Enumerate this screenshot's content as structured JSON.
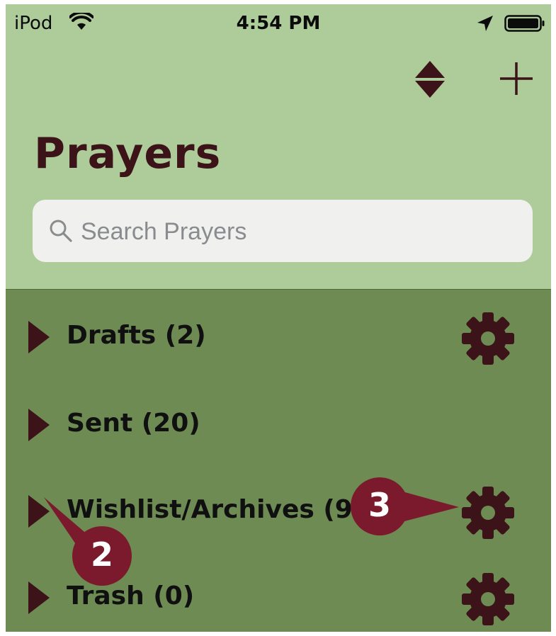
{
  "status_bar": {
    "carrier": "iPod",
    "time": "4:54 PM",
    "wifi_icon": "wifi-icon",
    "location_icon": "location-arrow-icon",
    "battery_icon": "battery-full-icon"
  },
  "toolbar": {
    "sort_icon": "sort-updown-icon",
    "add_icon": "plus-icon"
  },
  "page": {
    "title": "Prayers"
  },
  "search": {
    "placeholder": "Search Prayers",
    "value": ""
  },
  "folders": [
    {
      "label": "Drafts (2)",
      "has_settings": true
    },
    {
      "label": "Sent (20)",
      "has_settings": false
    },
    {
      "label": "Wishlist/Archives (9)",
      "has_settings": true
    },
    {
      "label": "Trash (0)",
      "has_settings": true
    }
  ],
  "callouts": [
    {
      "number": "2"
    },
    {
      "number": "3"
    }
  ],
  "colors": {
    "header_bg": "#aecb9a",
    "list_bg": "#6e8b53",
    "accent_dark": "#3b1318",
    "callout": "#7a1a2c"
  }
}
